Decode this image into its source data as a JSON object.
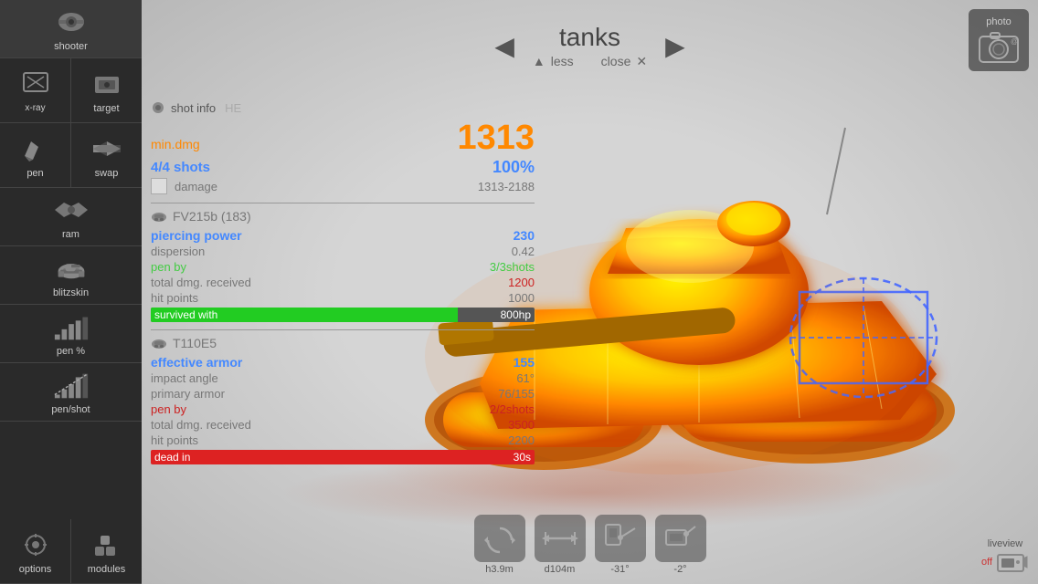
{
  "sidebar": {
    "items": [
      {
        "id": "shooter",
        "label": "shooter"
      },
      {
        "id": "target",
        "label": "target"
      },
      {
        "id": "pen",
        "label": "pen"
      },
      {
        "id": "swap",
        "label": "swap"
      },
      {
        "id": "ram",
        "label": "ram"
      },
      {
        "id": "blitzskin",
        "label": "blitzskin"
      },
      {
        "id": "pen_pct",
        "label": "pen %"
      },
      {
        "id": "pen_shot",
        "label": "pen/shot"
      },
      {
        "id": "options",
        "label": "options"
      },
      {
        "id": "modules",
        "label": "modules"
      }
    ]
  },
  "nav": {
    "title": "tanks",
    "less_label": "less",
    "close_label": "close",
    "prev_icon": "◀",
    "next_icon": "▶",
    "less_icon": "▲",
    "close_icon": "✕"
  },
  "photo_btn": {
    "label": "photo"
  },
  "shot_info": {
    "header": "shot info",
    "ammo_type": "HE",
    "min_dmg_label": "min.dmg",
    "min_dmg_value": "1313",
    "shots_label": "4/4 shots",
    "shots_pct": "100%",
    "damage_label": "damage",
    "damage_range": "1313-2188"
  },
  "tank_fv": {
    "name": "FV215b (183)",
    "piercing_power_label": "piercing power",
    "piercing_power_value": "230",
    "dispersion_label": "dispersion",
    "dispersion_value": "0.42",
    "pen_by_label": "pen by",
    "pen_by_value": "3/3shots",
    "total_dmg_label": "total dmg. received",
    "total_dmg_value": "1200",
    "hit_points_label": "hit points",
    "hit_points_value": "1000",
    "survived_label": "survived with",
    "survived_value": "800hp",
    "survived_bar_pct": 80
  },
  "tank_t110": {
    "name": "T110E5",
    "effective_armor_label": "effective armor",
    "effective_armor_value": "155",
    "impact_angle_label": "impact angle",
    "impact_angle_value": "61°",
    "primary_armor_label": "primary armor",
    "primary_armor_value": "76/155",
    "pen_by_label": "pen by",
    "pen_by_value": "2/2shots",
    "total_dmg_label": "total dmg. received",
    "total_dmg_value": "3500",
    "hit_points_label": "hit points",
    "hit_points_value": "2200",
    "dead_in_label": "dead in",
    "dead_in_value": "30s",
    "dead_bar_pct": 100
  },
  "bottom_controls": [
    {
      "id": "rotate",
      "label": "h3.9m"
    },
    {
      "id": "distance",
      "label": "d104m"
    },
    {
      "id": "angle1",
      "label": "-31°"
    },
    {
      "id": "angle2",
      "label": "-2°"
    }
  ],
  "liveview": {
    "label": "liveview",
    "status": "off"
  },
  "colors": {
    "orange": "#ff8800",
    "blue": "#4488ff",
    "green": "#22cc22",
    "red": "#cc2222",
    "sidebar_bg": "#2a2a2a",
    "accent_blue": "#4466ff"
  }
}
